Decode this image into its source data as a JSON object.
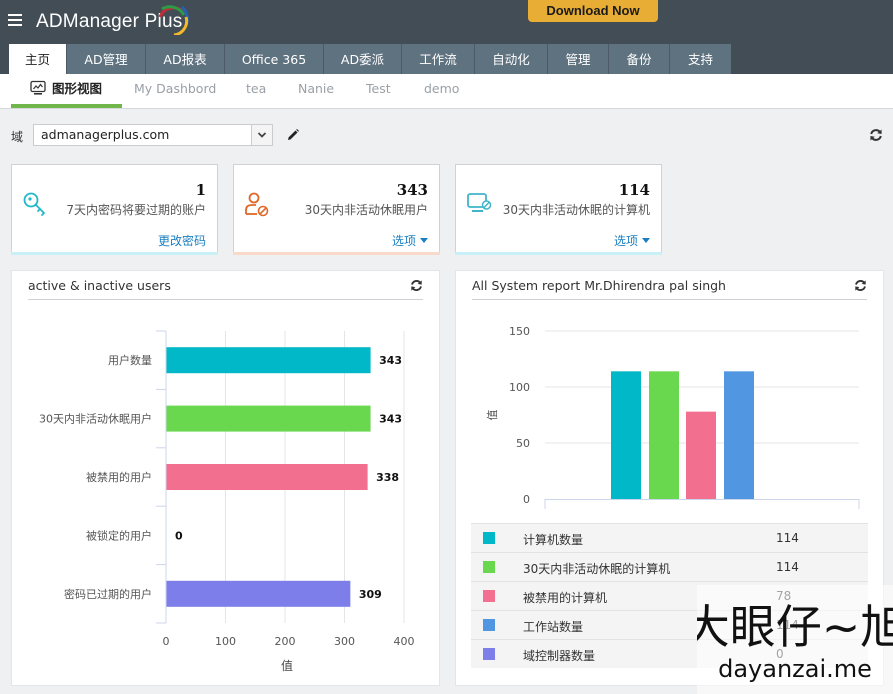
{
  "app": {
    "title": "ADManager Plus",
    "download_label": "Download Now"
  },
  "nav": {
    "tabs": [
      {
        "label": "主页",
        "active": true
      },
      {
        "label": "AD管理"
      },
      {
        "label": "AD报表"
      },
      {
        "label": "Office 365"
      },
      {
        "label": "AD委派"
      },
      {
        "label": "工作流"
      },
      {
        "label": "自动化"
      },
      {
        "label": "管理"
      },
      {
        "label": "备份"
      },
      {
        "label": "支持"
      }
    ]
  },
  "subnav": {
    "tabs": [
      {
        "label": "图形视图",
        "icon": "chart-monitor-icon",
        "active": true
      },
      {
        "label": "My Dashbord"
      },
      {
        "label": "tea"
      },
      {
        "label": "Nanie"
      },
      {
        "label": "Test"
      },
      {
        "label": "demo"
      }
    ]
  },
  "domain": {
    "label": "域",
    "value": "admanagerplus.com"
  },
  "cards": [
    {
      "icon": "key-icon",
      "value": "1",
      "desc": "7天内密码将要过期的账户",
      "link": "更改密码",
      "has_caret": false,
      "accent": "#21b8c9",
      "bar": "#c9eff7"
    },
    {
      "icon": "user-blocked-icon",
      "value": "343",
      "desc": "30天内非活动休眠用户",
      "link": "选项",
      "has_caret": true,
      "accent": "#e0692a",
      "bar": "#f9d9c9"
    },
    {
      "icon": "computer-blocked-icon",
      "value": "114",
      "desc": "30天内非活动休眠的计算机",
      "link": "选项",
      "has_caret": true,
      "accent": "#3fb5c9",
      "bar": "#c9eff7"
    }
  ],
  "panels": {
    "left": {
      "title": "active & inactive users"
    },
    "right": {
      "title": "All System report Mr.Dhirendra pal singh"
    }
  },
  "chart_data": [
    {
      "type": "bar",
      "orientation": "horizontal",
      "title": "active & inactive users",
      "categories": [
        "用户数量",
        "30天内非活动休眠用户",
        "被禁用的用户",
        "被锁定的用户",
        "密码已过期的用户"
      ],
      "values": [
        343,
        343,
        338,
        0,
        309
      ],
      "colors": [
        "#00b8c8",
        "#6ad84f",
        "#f26f8f",
        "#5b9ee3",
        "#7d7ee9"
      ],
      "xlabel": "值",
      "ylabel": "",
      "xlim": [
        0,
        400
      ],
      "xticks": [
        0,
        100,
        200,
        300,
        400
      ],
      "grid": true,
      "data_labels": true
    },
    {
      "type": "bar",
      "orientation": "vertical",
      "title": "All System report Mr.Dhirendra pal singh",
      "categories": [
        "计算机数量",
        "30天内非活动休眠的计算机",
        "被禁用的计算机",
        "工作站数量",
        "域控制器数量"
      ],
      "values": [
        114,
        114,
        78,
        114,
        0
      ],
      "colors": [
        "#00b8c8",
        "#6ad84f",
        "#f26f8f",
        "#5196e0",
        "#7d7ee9"
      ],
      "xlabel": "",
      "ylabel": "值",
      "ylim": [
        0,
        150
      ],
      "yticks": [
        0,
        50,
        100,
        150
      ],
      "grid": true,
      "legend": "bottom-table"
    }
  ],
  "watermark": {
    "text": "大眼仔~旭",
    "url_text": "dayanzai.me"
  }
}
